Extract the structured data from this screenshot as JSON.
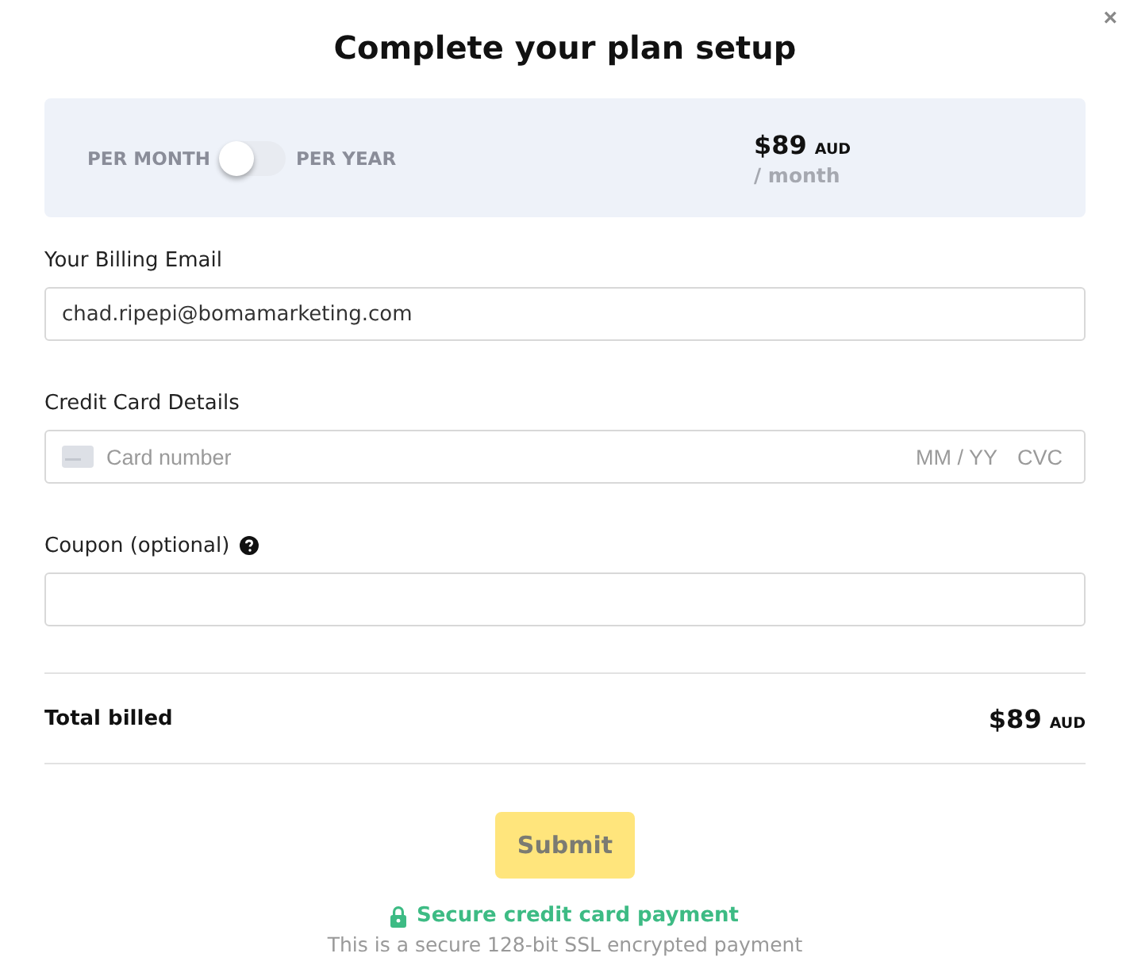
{
  "dialog": {
    "title": "Complete your plan setup",
    "close": "×"
  },
  "plan": {
    "left_label": "PER MONTH",
    "right_label": "PER YEAR",
    "per_year": false,
    "price": "$89",
    "currency": "AUD",
    "period": "/ month"
  },
  "fields": [
    {
      "label": "Your Billing Email",
      "value": "chad.ripepi@bomamarketing.com",
      "kind": "text"
    },
    {
      "label": "Credit Card Details",
      "placeholder": "Card number",
      "expiry_placeholder": "MM / YY",
      "cvc_placeholder": "CVC",
      "kind": "card"
    },
    {
      "label": "Coupon (optional)",
      "help": true,
      "kind": "text"
    }
  ],
  "total": {
    "label": "Total billed",
    "price": "$89",
    "currency": "AUD"
  },
  "submit": {
    "label": "Submit",
    "disabled": true
  },
  "secure": {
    "title": "Secure credit card payment",
    "note": "This is a secure 128-bit SSL encrypted payment"
  }
}
